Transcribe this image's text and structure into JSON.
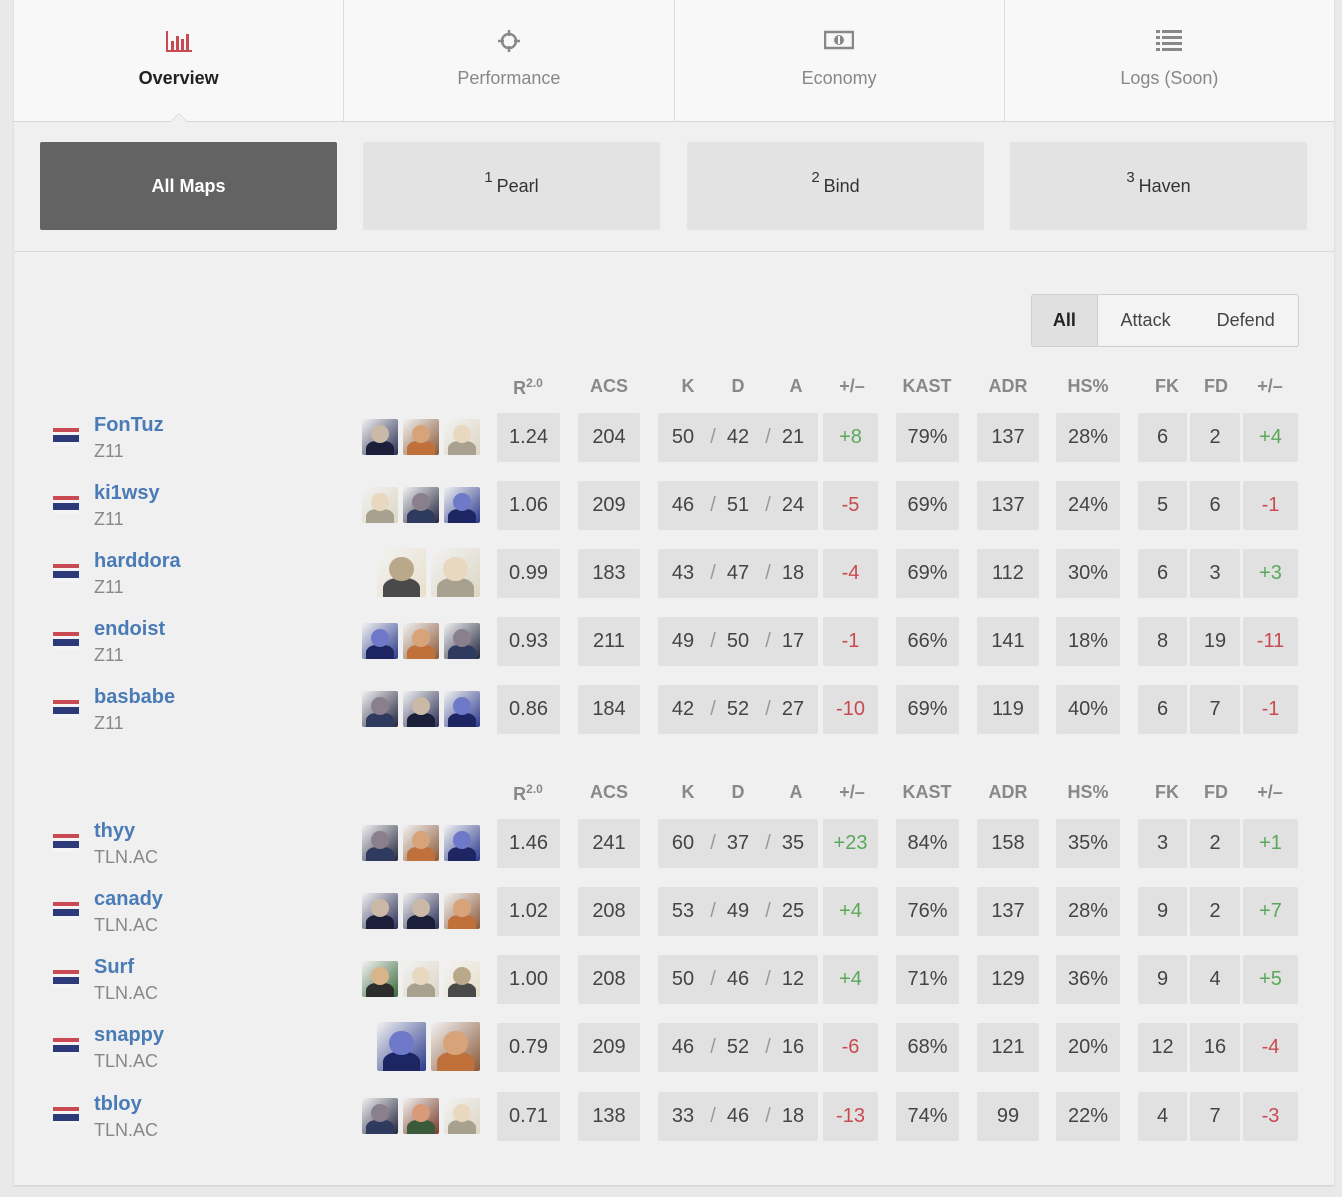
{
  "tabs": [
    {
      "label": "Overview",
      "icon": "bar-chart-icon",
      "active": true
    },
    {
      "label": "Performance",
      "icon": "crosshair-icon",
      "active": false
    },
    {
      "label": "Economy",
      "icon": "money-icon",
      "active": false
    },
    {
      "label": "Logs (Soon)",
      "icon": "list-icon",
      "active": false
    }
  ],
  "maps": [
    {
      "num": "",
      "label": "All Maps",
      "active": true
    },
    {
      "num": "1",
      "label": "Pearl",
      "active": false
    },
    {
      "num": "2",
      "label": "Bind",
      "active": false
    },
    {
      "num": "3",
      "label": "Haven",
      "active": false
    }
  ],
  "sides": [
    "All",
    "Attack",
    "Defend"
  ],
  "headers": {
    "rating": "R",
    "rating_sup": "2.0",
    "acs": "ACS",
    "k": "K",
    "d": "D",
    "a": "A",
    "pm": "+/–",
    "kast": "KAST",
    "adr": "ADR",
    "hs": "HS%",
    "fk": "FK",
    "fd": "FD",
    "fkpm": "+/–"
  },
  "teams": [
    {
      "players": [
        {
          "name": "FonTuz",
          "team": "Z11",
          "agents": [
            "a-navy",
            "a-orange",
            "a-blonde"
          ],
          "rating": "1.24",
          "acs": "204",
          "k": "50",
          "d": "42",
          "a": "21",
          "pm": "+8",
          "kast": "79%",
          "adr": "137",
          "hs": "28%",
          "fk": "6",
          "fd": "2",
          "fkpm": "+4"
        },
        {
          "name": "ki1wsy",
          "team": "Z11",
          "agents": [
            "a-blonde",
            "a-dark",
            "a-blue"
          ],
          "rating": "1.06",
          "acs": "209",
          "k": "46",
          "d": "51",
          "a": "24",
          "pm": "-5",
          "kast": "69%",
          "adr": "137",
          "hs": "24%",
          "fk": "5",
          "fd": "6",
          "fkpm": "-1"
        },
        {
          "name": "harddora",
          "team": "Z11",
          "agents": [
            "a-hat",
            "a-blonde"
          ],
          "big": true,
          "rating": "0.99",
          "acs": "183",
          "k": "43",
          "d": "47",
          "a": "18",
          "pm": "-4",
          "kast": "69%",
          "adr": "112",
          "hs": "30%",
          "fk": "6",
          "fd": "3",
          "fkpm": "+3"
        },
        {
          "name": "endoist",
          "team": "Z11",
          "agents": [
            "a-blue",
            "a-orange",
            "a-dark"
          ],
          "rating": "0.93",
          "acs": "211",
          "k": "49",
          "d": "50",
          "a": "17",
          "pm": "-1",
          "kast": "66%",
          "adr": "141",
          "hs": "18%",
          "fk": "8",
          "fd": "19",
          "fkpm": "-11"
        },
        {
          "name": "basbabe",
          "team": "Z11",
          "agents": [
            "a-dark",
            "a-navy",
            "a-blue"
          ],
          "rating": "0.86",
          "acs": "184",
          "k": "42",
          "d": "52",
          "a": "27",
          "pm": "-10",
          "kast": "69%",
          "adr": "119",
          "hs": "40%",
          "fk": "6",
          "fd": "7",
          "fkpm": "-1"
        }
      ]
    },
    {
      "players": [
        {
          "name": "thyy",
          "team": "TLN.AC",
          "agents": [
            "a-dark",
            "a-orange",
            "a-blue"
          ],
          "rating": "1.46",
          "acs": "241",
          "k": "60",
          "d": "37",
          "a": "35",
          "pm": "+23",
          "kast": "84%",
          "adr": "158",
          "hs": "35%",
          "fk": "3",
          "fd": "2",
          "fkpm": "+1"
        },
        {
          "name": "canady",
          "team": "TLN.AC",
          "agents": [
            "a-navy",
            "a-navy",
            "a-orange"
          ],
          "rating": "1.02",
          "acs": "208",
          "k": "53",
          "d": "49",
          "a": "25",
          "pm": "+4",
          "kast": "76%",
          "adr": "137",
          "hs": "28%",
          "fk": "9",
          "fd": "2",
          "fkpm": "+7"
        },
        {
          "name": "Surf",
          "team": "TLN.AC",
          "agents": [
            "a-green",
            "a-blonde",
            "a-hat"
          ],
          "rating": "1.00",
          "acs": "208",
          "k": "50",
          "d": "46",
          "a": "12",
          "pm": "+4",
          "kast": "71%",
          "adr": "129",
          "hs": "36%",
          "fk": "9",
          "fd": "4",
          "fkpm": "+5"
        },
        {
          "name": "snappy",
          "team": "TLN.AC",
          "agents": [
            "a-blue",
            "a-orange"
          ],
          "big": true,
          "rating": "0.79",
          "acs": "209",
          "k": "46",
          "d": "52",
          "a": "16",
          "pm": "-6",
          "kast": "68%",
          "adr": "121",
          "hs": "20%",
          "fk": "12",
          "fd": "16",
          "fkpm": "-4"
        },
        {
          "name": "tbloy",
          "team": "TLN.AC",
          "agents": [
            "a-dark",
            "a-red",
            "a-blonde"
          ],
          "rating": "0.71",
          "acs": "138",
          "k": "33",
          "d": "46",
          "a": "18",
          "pm": "-13",
          "kast": "74%",
          "adr": "99",
          "hs": "22%",
          "fk": "4",
          "fd": "7",
          "fkpm": "-3"
        }
      ]
    }
  ],
  "colors": {
    "positive": "#5aa85a",
    "negative": "#c94a52",
    "link": "#4a7bb7",
    "accent": "#c94a52"
  }
}
